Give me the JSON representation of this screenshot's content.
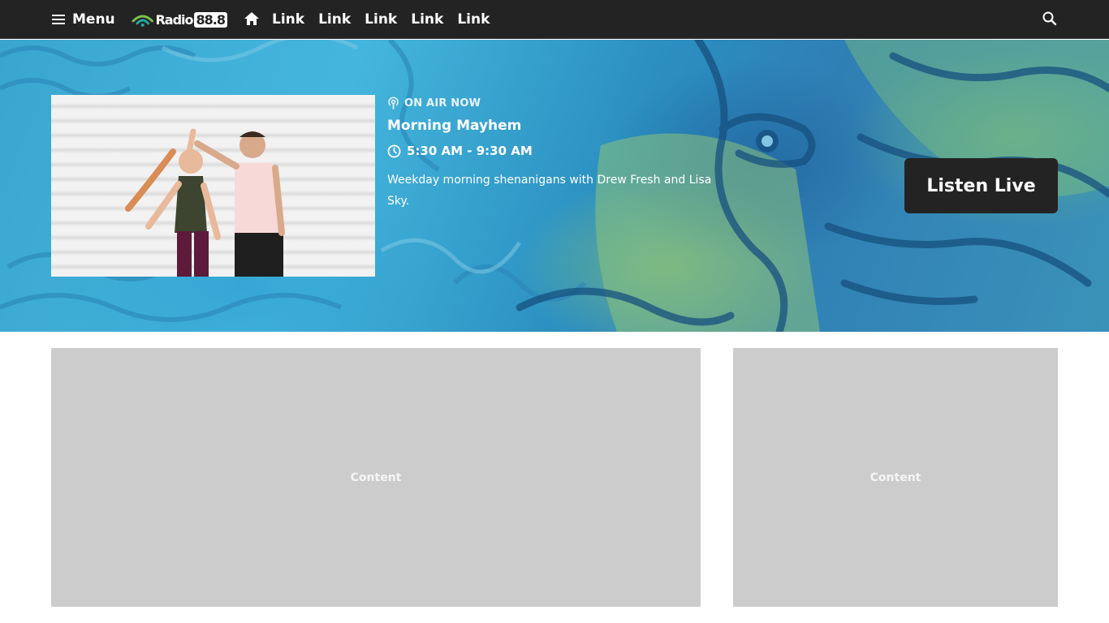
{
  "nav": {
    "menu_label": "Menu",
    "logo": {
      "name": "Radio",
      "frequency": "88.8"
    },
    "links": [
      "Link",
      "Link",
      "Link",
      "Link",
      "Link"
    ]
  },
  "hero": {
    "on_air_label": "ON AIR NOW",
    "show_title": "Morning Mayhem",
    "show_time": "5:30 AM - 9:30 AM",
    "show_description": "Weekday morning shenanigans with Drew Fresh and Lisa Sky.",
    "listen_live_label": "Listen Live"
  },
  "content": {
    "main_label": "Content",
    "side_label": "Content"
  },
  "icons": {
    "menu": "menu-icon",
    "home": "home-icon",
    "search": "search-icon",
    "on_air": "podcast-icon",
    "clock": "clock-icon"
  },
  "colors": {
    "nav_background": "#232323",
    "button_background": "#232323",
    "placeholder": "#cccccc",
    "logo_green": "#7ec24a",
    "logo_teal": "#26a7a0"
  }
}
